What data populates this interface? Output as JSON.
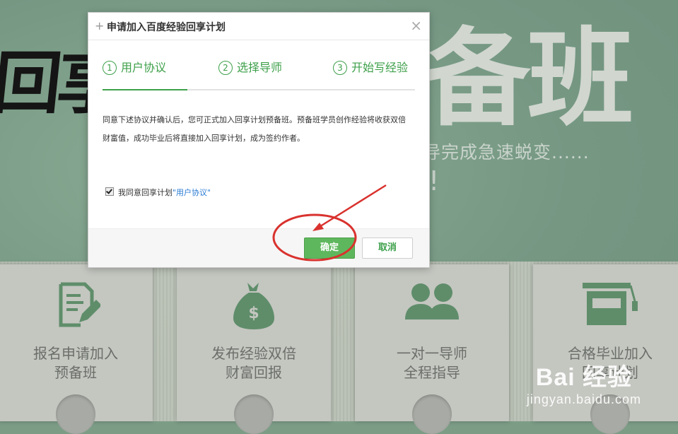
{
  "background": {
    "brush_left": "回享",
    "brush_right": "备班",
    "subtitle": "导完成急速蜕变......",
    "exclaim": "!"
  },
  "cards": [
    {
      "icon": "document-edit-icon",
      "line1": "报名申请加入",
      "line2": "预备班"
    },
    {
      "icon": "money-bag-icon",
      "line1": "发布经验双倍",
      "line2": "财富回报"
    },
    {
      "icon": "users-icon",
      "line1": "一对一导师",
      "line2": "全程指导"
    },
    {
      "icon": "graduation-cap-icon",
      "line1": "合格毕业加入",
      "line2": "回享计划"
    }
  ],
  "watermark": {
    "brand": "Bai 经验",
    "url": "jingyan.baidu.com"
  },
  "dialog": {
    "plus": "+",
    "title": "申请加入百度经验回享计划",
    "close": "×",
    "steps": [
      {
        "num": "1",
        "label": "用户协议"
      },
      {
        "num": "2",
        "label": "选择导师"
      },
      {
        "num": "3",
        "label": "开始写经验"
      }
    ],
    "description": "同意下述协议并确认后，您可正式加入回享计划预备班。预备班学员创作经验将收获双倍财富值，成功毕业后将直接加入回享计划，成为签约作者。",
    "agree_prefix": "我同意回享计划",
    "agree_link": "\"用户协议\"",
    "ok_label": "确定",
    "cancel_label": "取消"
  },
  "colors": {
    "accent": "#3da04a",
    "annotation": "#d9322e"
  }
}
